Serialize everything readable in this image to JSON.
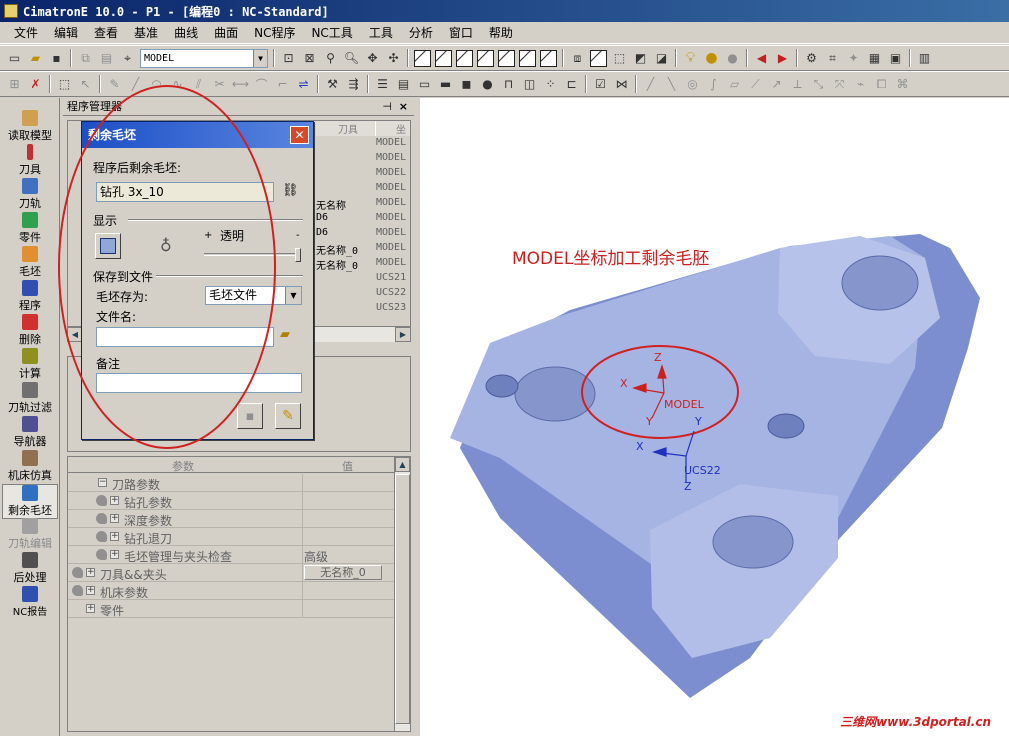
{
  "window": {
    "title": "CimatronE 10.0 - P1 - [编程0 : NC-Standard]"
  },
  "menu": [
    "文件",
    "编辑",
    "查看",
    "基准",
    "曲线",
    "曲面",
    "NC程序",
    "NC工具",
    "工具",
    "分析",
    "窗口",
    "帮助"
  ],
  "toolbar": {
    "model_combo": "MODEL"
  },
  "left_toolbar": [
    {
      "label": "读取模型",
      "icon": "read-model-icon",
      "color": "#c08020"
    },
    {
      "label": "刀具",
      "icon": "tool-icon",
      "color": "#c02020"
    },
    {
      "label": "刀轨",
      "icon": "toolpath-icon",
      "color": "#2060c0"
    },
    {
      "label": "零件",
      "icon": "part-icon",
      "color": "#20a040"
    },
    {
      "label": "毛坯",
      "icon": "stock-icon",
      "color": "#d08020"
    },
    {
      "label": "程序",
      "icon": "program-icon",
      "color": "#2040a0"
    },
    {
      "label": "删除",
      "icon": "delete-icon",
      "color": "#c02020"
    },
    {
      "label": "计算",
      "icon": "compute-icon",
      "color": "#808000"
    },
    {
      "label": "刀轨过滤",
      "icon": "filter-icon",
      "color": "#606060"
    },
    {
      "label": "导航器",
      "icon": "navigator-icon",
      "color": "#404080"
    },
    {
      "label": "机床仿真",
      "icon": "machine-sim-icon",
      "color": "#806040"
    },
    {
      "label": "剩余毛坯",
      "icon": "remaining-stock-icon",
      "color": "#2060c0"
    },
    {
      "label": "刀轨编辑",
      "icon": "toolpath-edit-icon",
      "color": "#909090"
    },
    {
      "label": "后处理",
      "icon": "post-process-icon",
      "color": "#404040"
    },
    {
      "label": "NC报告",
      "icon": "nc-report-icon",
      "color": "#2040a0"
    }
  ],
  "program_manager": {
    "title": "程序管理器",
    "col_tool": "刀具",
    "col_ucs": "坐",
    "rows": [
      {
        "tool": "",
        "ucs": "MODEL"
      },
      {
        "tool": "",
        "ucs": "MODEL"
      },
      {
        "tool": "",
        "ucs": "MODEL"
      },
      {
        "tool": "",
        "ucs": "MODEL"
      },
      {
        "tool": "无名称",
        "ucs": "MODEL"
      },
      {
        "tool": "D6",
        "ucs": "MODEL"
      },
      {
        "tool": "D6",
        "ucs": "MODEL"
      },
      {
        "tool": "无名称_0",
        "ucs": "MODEL"
      },
      {
        "tool": "无名称_0",
        "ucs": "MODEL"
      },
      {
        "tool": "",
        "ucs": "UCS21"
      },
      {
        "tool": "",
        "ucs": "UCS22"
      },
      {
        "tool": "",
        "ucs": "UCS23"
      }
    ]
  },
  "params": {
    "col_param": "参数",
    "col_value": "值",
    "rows": [
      {
        "label": "刀路参数",
        "value": "",
        "indent": 1,
        "box": "−",
        "tool": false
      },
      {
        "label": "钻孔参数",
        "value": "",
        "indent": 2,
        "box": "+",
        "tool": true
      },
      {
        "label": "深度参数",
        "value": "",
        "indent": 2,
        "box": "+",
        "tool": true
      },
      {
        "label": "钻孔退刀",
        "value": "",
        "indent": 2,
        "box": "+",
        "tool": true
      },
      {
        "label": "毛坯管理与夹头检查",
        "value": "高级",
        "indent": 2,
        "box": "+",
        "tool": true
      },
      {
        "label": "刀具&&夹头",
        "value": "无名称_0",
        "indent": 0,
        "box": "+",
        "tool": true
      },
      {
        "label": "机床参数",
        "value": "",
        "indent": 0,
        "box": "+",
        "tool": true
      },
      {
        "label": "零件",
        "value": "",
        "indent": 0,
        "box": "+",
        "tool": false
      }
    ]
  },
  "dialog": {
    "title": "剩余毛坯",
    "remaining_label": "程序后剩余毛坯:",
    "remaining_value": "钻孔 3x_10",
    "display_section": "显示",
    "plus": "+",
    "transparency_label": "透明",
    "minus": "-",
    "transparency_value": 1.0,
    "save_section": "保存到文件",
    "save_as_label": "毛坯存为:",
    "save_as_value": "毛坯文件",
    "filename_label": "文件名:",
    "filename_value": "",
    "notes_label": "备注",
    "notes_value": ""
  },
  "viewport": {
    "annotation": "MODEL坐标加工剩余毛胚",
    "model_csys": {
      "name": "MODEL",
      "x": "X",
      "y": "Y",
      "z": "Z"
    },
    "ucs22_csys": {
      "name": "UCS22",
      "x": "X",
      "y": "Y",
      "z": "Z"
    },
    "watermark": "三维网www.3dportal.cn"
  },
  "colors": {
    "annotation": "#cc2020",
    "part_face": "#9eaede",
    "part_side": "#7a8acc",
    "model_csys": "#cc2020",
    "ucs_csys": "#2030c0"
  }
}
